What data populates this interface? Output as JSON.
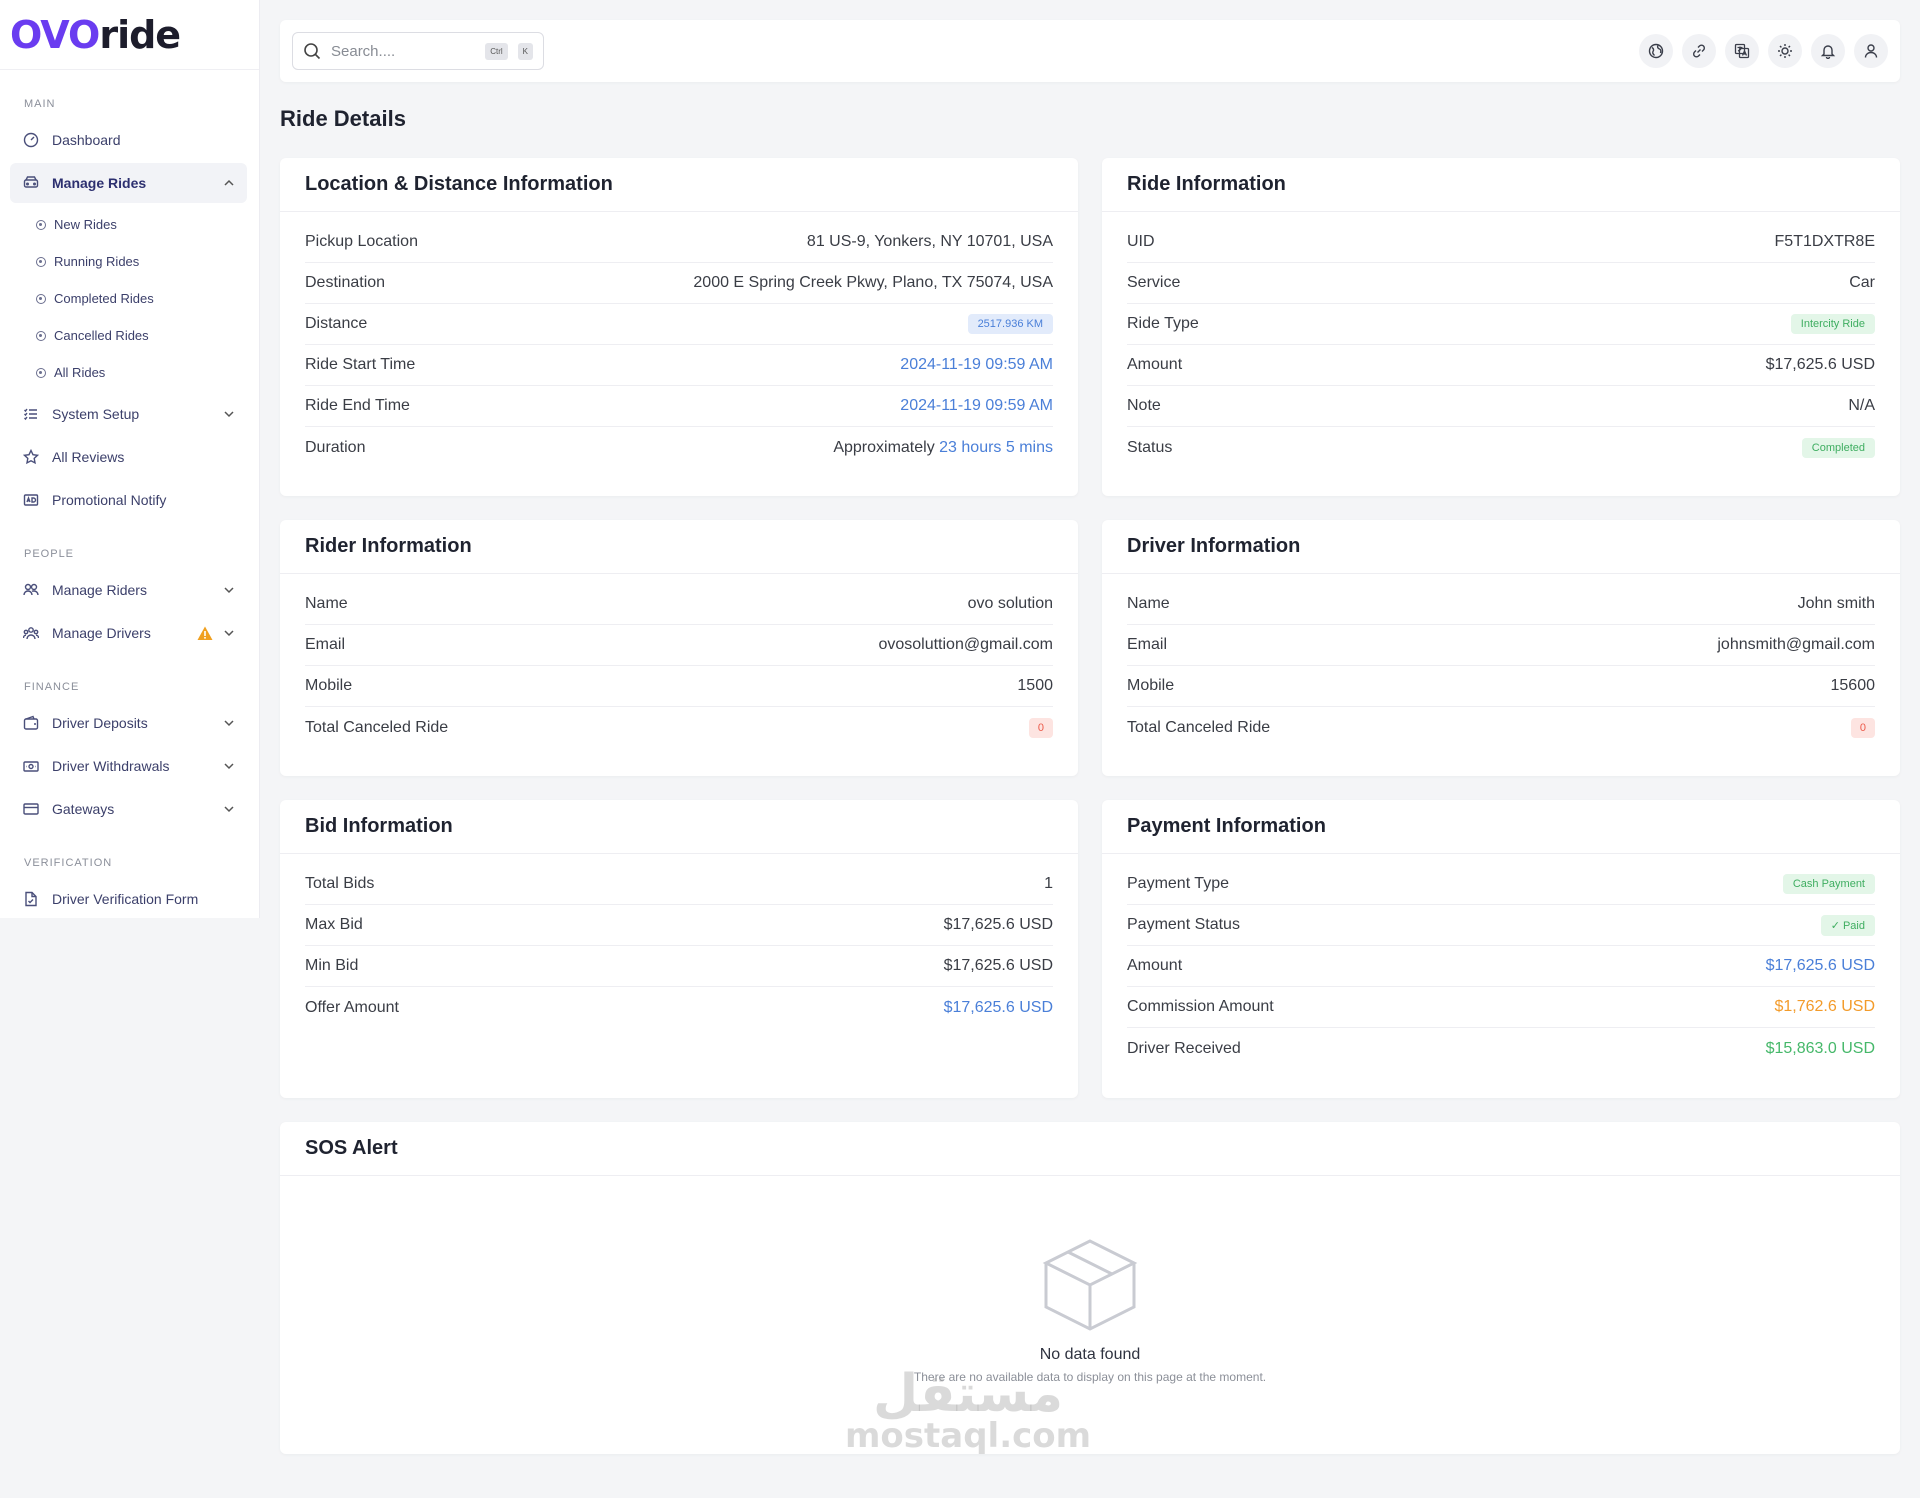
{
  "logo": {
    "part1": "OVO",
    "part2": "ride"
  },
  "sidebar": {
    "sections": {
      "main": "MAIN",
      "people": "PEOPLE",
      "finance": "FINANCE",
      "verification": "VERIFICATION"
    },
    "dashboard": "Dashboard",
    "manage_rides": "Manage Rides",
    "sub_items": [
      "New Rides",
      "Running Rides",
      "Completed Rides",
      "Cancelled Rides",
      "All Rides"
    ],
    "system_setup": "System Setup",
    "all_reviews": "All Reviews",
    "promotional_notify": "Promotional Notify",
    "manage_riders": "Manage Riders",
    "manage_drivers": "Manage Drivers",
    "driver_deposits": "Driver Deposits",
    "driver_withdrawals": "Driver Withdrawals",
    "gateways": "Gateways",
    "driver_verification_form": "Driver Verification Form"
  },
  "search": {
    "placeholder": "Search....",
    "kbd1": "Ctrl",
    "kbd2": "K"
  },
  "page_title": "Ride Details",
  "location": {
    "title": "Location & Distance Information",
    "pickup_label": "Pickup Location",
    "pickup": "81 US-9, Yonkers, NY 10701, USA",
    "destination_label": "Destination",
    "destination": "2000 E Spring Creek Pkwy, Plano, TX 75074, USA",
    "distance_label": "Distance",
    "distance": "2517.936 KM",
    "start_label": "Ride Start Time",
    "start": "2024-11-19 09:59 AM",
    "end_label": "Ride End Time",
    "end": "2024-11-19 09:59 AM",
    "duration_label": "Duration",
    "duration_prefix": "Approximately",
    "duration": "23 hours 5 mins"
  },
  "ride": {
    "title": "Ride Information",
    "uid_label": "UID",
    "uid": "F5T1DXTR8E",
    "service_label": "Service",
    "service": "Car",
    "type_label": "Ride Type",
    "type": "Intercity Ride",
    "amount_label": "Amount",
    "amount": "$17,625.6 USD",
    "note_label": "Note",
    "note": "N/A",
    "status_label": "Status",
    "status": "Completed"
  },
  "rider": {
    "title": "Rider Information",
    "name_label": "Name",
    "name": "ovo solution",
    "email_label": "Email",
    "email": "ovosoluttion@gmail.com",
    "mobile_label": "Mobile",
    "mobile": "1500",
    "canceled_label": "Total Canceled Ride",
    "canceled": "0"
  },
  "driver": {
    "title": "Driver Information",
    "name_label": "Name",
    "name": "John smith",
    "email_label": "Email",
    "email": "johnsmith@gmail.com",
    "mobile_label": "Mobile",
    "mobile": "15600",
    "canceled_label": "Total Canceled Ride",
    "canceled": "0"
  },
  "bid": {
    "title": "Bid Information",
    "total_label": "Total Bids",
    "total": "1",
    "max_label": "Max Bid",
    "max": "$17,625.6 USD",
    "min_label": "Min Bid",
    "min": "$17,625.6 USD",
    "offer_label": "Offer Amount",
    "offer": "$17,625.6 USD"
  },
  "payment": {
    "title": "Payment Information",
    "type_label": "Payment Type",
    "type": "Cash Payment",
    "status_label": "Payment Status",
    "status": "Paid",
    "amount_label": "Amount",
    "amount": "$17,625.6 USD",
    "commission_label": "Commission Amount",
    "commission": "$1,762.6 USD",
    "received_label": "Driver Received",
    "received": "$15,863.0 USD"
  },
  "sos": {
    "title": "SOS Alert",
    "empty_title": "No data found",
    "empty_sub": "There are no available data to display on this page at the moment."
  },
  "watermark": {
    "arabic": "مستقل",
    "latin": "mostaql.com"
  },
  "colors": {
    "accent": "#6a3cf0",
    "link_blue": "#4a7fd8",
    "success": "#46b86a",
    "warning": "#f39b2a",
    "danger": "#ec5a4a"
  }
}
